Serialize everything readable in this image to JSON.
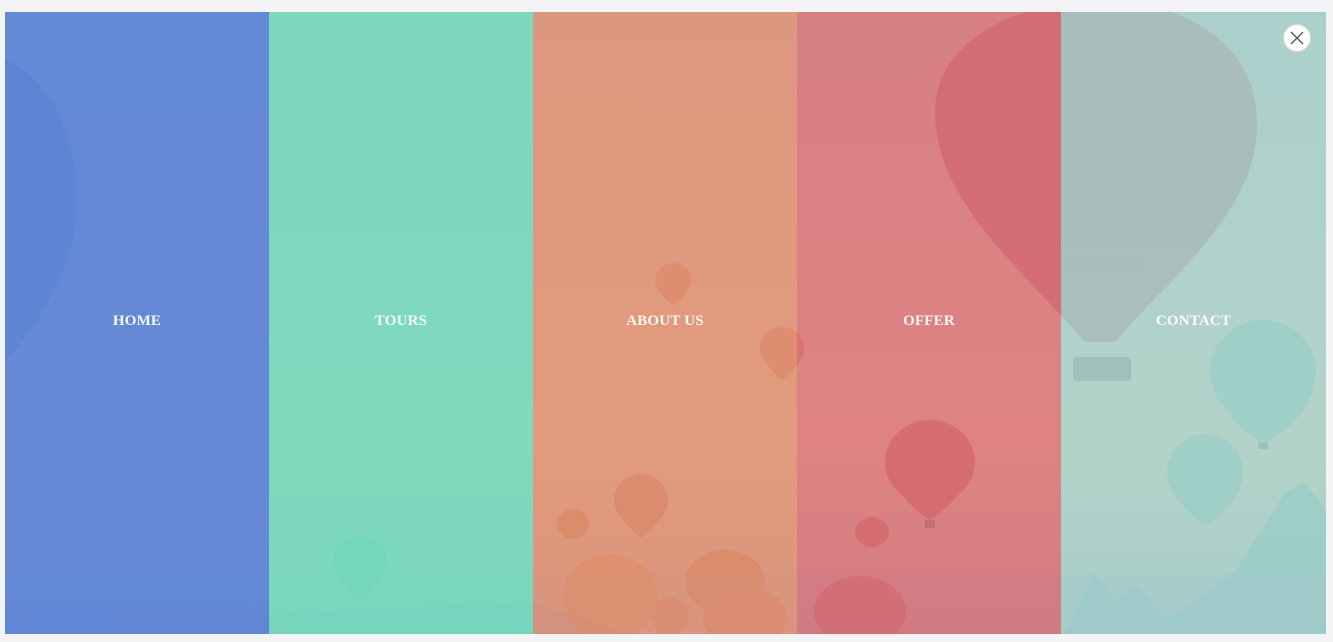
{
  "menu": {
    "items": [
      {
        "label": "HOME",
        "color": "#5b84d8"
      },
      {
        "label": "TOURS",
        "color": "#72dcbf"
      },
      {
        "label": "ABOUT US",
        "color": "#e0937a"
      },
      {
        "label": "OFFER",
        "color": "#d9757a"
      },
      {
        "label": "CONTACT",
        "color": "#9fd6d2"
      }
    ]
  },
  "close_button": {
    "icon": "close-icon"
  },
  "background": {
    "subject": "hot-air-balloons"
  }
}
